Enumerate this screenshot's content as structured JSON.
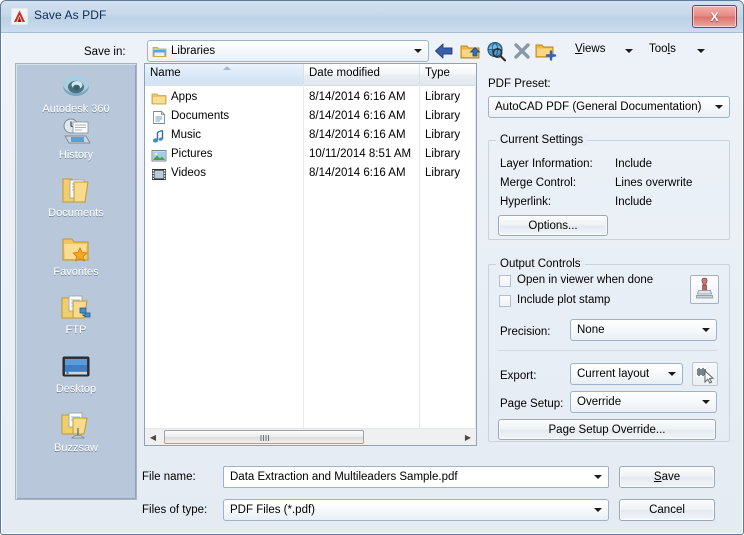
{
  "window": {
    "title": "Save As PDF",
    "app_icon": "autodesk-a-icon",
    "close_label": "X"
  },
  "toolbar": {
    "savein_label": "Save in:",
    "savein_value": "Libraries",
    "icons": [
      {
        "name": "back-icon",
        "title": "Back"
      },
      {
        "name": "up-folder-icon",
        "title": "Up one level"
      },
      {
        "name": "search-folder-icon",
        "title": "Search the Web"
      },
      {
        "name": "delete-icon",
        "title": "Delete"
      },
      {
        "name": "new-folder-icon",
        "title": "Create New Folder"
      }
    ],
    "views_label": "Views",
    "views_accesskey": "V",
    "tools_label": "Tools",
    "tools_accesskey": "l"
  },
  "places": {
    "items": [
      {
        "label": "Autodesk 360",
        "icon": "autodesk-360-icon"
      },
      {
        "label": "History",
        "icon": "history-icon"
      },
      {
        "label": "Documents",
        "icon": "documents-folder-icon"
      },
      {
        "label": "Favorites",
        "icon": "favorites-folder-icon"
      },
      {
        "label": "FTP",
        "icon": "ftp-folder-icon"
      },
      {
        "label": "Desktop",
        "icon": "desktop-icon"
      },
      {
        "label": "Buzzsaw",
        "icon": "buzzsaw-folder-icon"
      }
    ]
  },
  "filelist": {
    "columns": [
      "Name",
      "Date modified",
      "Type"
    ],
    "sort_column": "Name",
    "sort_direction": "ascending",
    "rows": [
      {
        "name": "Apps",
        "icon": "folder-icon",
        "date": "8/14/2014 6:16 AM",
        "type": "Library"
      },
      {
        "name": "Documents",
        "icon": "document-icon",
        "date": "8/14/2014 6:16 AM",
        "type": "Library"
      },
      {
        "name": "Music",
        "icon": "music-note-icon",
        "date": "8/14/2014 6:16 AM",
        "type": "Library"
      },
      {
        "name": "Pictures",
        "icon": "picture-icon",
        "date": "10/11/2014 8:51 AM",
        "type": "Library"
      },
      {
        "name": "Videos",
        "icon": "film-icon",
        "date": "8/14/2014 6:16 AM",
        "type": "Library"
      }
    ],
    "scroll_left_glyph": "◀",
    "scroll_right_glyph": "▶"
  },
  "right_panel": {
    "pdf_preset_label": "PDF Preset:",
    "pdf_preset_value": "AutoCAD PDF (General Documentation)",
    "current_settings": {
      "title": "Current Settings",
      "rows": [
        {
          "label": "Layer Information:",
          "value": "Include"
        },
        {
          "label": "Merge Control:",
          "value": "Lines overwrite"
        },
        {
          "label": "Hyperlink:",
          "value": "Include"
        }
      ],
      "options_button": "Options..."
    },
    "output_controls": {
      "title": "Output Controls",
      "open_in_viewer_label": "Open in viewer when done",
      "open_in_viewer_checked": false,
      "include_plot_stamp_label": "Include plot stamp",
      "include_plot_stamp_checked": false,
      "stamp_settings_icon": "plot-stamp-icon",
      "precision_label": "Precision:",
      "precision_value": "None",
      "export_label": "Export:",
      "export_value": "Current layout",
      "export_pick_icon": "select-objects-icon",
      "page_setup_label": "Page Setup:",
      "page_setup_value": "Override",
      "page_setup_override_button": "Page Setup Override..."
    }
  },
  "bottom": {
    "filename_label": "File name:",
    "filename_value": "Data Extraction and Multileaders Sample.pdf",
    "filetype_label": "Files of type:",
    "filetype_value": "PDF Files (*.pdf)",
    "save_button": "Save",
    "save_accesskey": "S",
    "cancel_button": "Cancel"
  },
  "colors": {
    "titlebar": "#c6d8ea",
    "dialog_bg": "#e9eef4",
    "places_bg": "#b8c8da",
    "close_red": "#d9736c",
    "selected_column": "#cfe2f6"
  }
}
